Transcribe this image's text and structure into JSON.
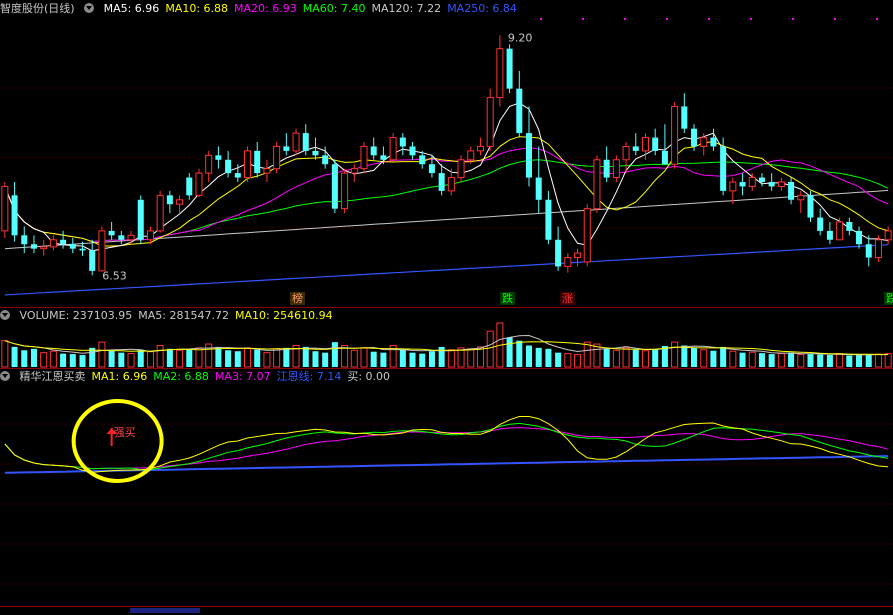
{
  "price_panel": {
    "name": "智度股份(日线)",
    "ma": [
      {
        "label": "MA5: 6.96",
        "color": "#ffffff"
      },
      {
        "label": "MA10: 6.88",
        "color": "#ffff00"
      },
      {
        "label": "MA20: 6.93",
        "color": "#ff00ff"
      },
      {
        "label": "MA60: 7.40",
        "color": "#00ff00"
      },
      {
        "label": "MA120: 7.22",
        "color": "#c8c8c8"
      },
      {
        "label": "MA250: 6.84",
        "color": "#3355ff"
      }
    ],
    "high_label": "9.20",
    "low_label": "6.53",
    "tags": [
      {
        "text": "榜",
        "color": "#ff9966"
      },
      {
        "text": "跌",
        "color": "#00ff00"
      },
      {
        "text": "涨",
        "color": "#ff3333"
      },
      {
        "text": "跌",
        "color": "#00ff00"
      }
    ]
  },
  "volume_panel": {
    "labels": [
      {
        "text": "VOLUME: 237103.95",
        "color": "#c8c8c8"
      },
      {
        "text": "MA5: 281547.72",
        "color": "#c8c8c8"
      },
      {
        "text": "MA10: 254610.94",
        "color": "#ffff00"
      }
    ]
  },
  "indicator_panel": {
    "labels": [
      {
        "text": "精华江恩买卖",
        "color": "#c8c8c8"
      },
      {
        "text": "MA1: 6.96",
        "color": "#ffff00"
      },
      {
        "text": "MA2: 6.88",
        "color": "#00ff00"
      },
      {
        "text": "MA3: 7.07",
        "color": "#ff00ff"
      },
      {
        "text": "江恩线: 7.14",
        "color": "#3355ff"
      },
      {
        "text": "买: 0.00",
        "color": "#c8c8c8"
      }
    ],
    "signal_label": "强买",
    "highlight_color": "#ffff00"
  },
  "candles": [
    [
      7.0,
      7.55,
      6.92,
      7.5
    ],
    [
      7.4,
      7.55,
      6.88,
      6.95
    ],
    [
      6.95,
      7.05,
      6.75,
      6.85
    ],
    [
      6.85,
      6.95,
      6.75,
      6.8
    ],
    [
      6.8,
      6.9,
      6.72,
      6.82
    ],
    [
      6.82,
      6.95,
      6.78,
      6.9
    ],
    [
      6.9,
      7.0,
      6.8,
      6.85
    ],
    [
      6.85,
      6.92,
      6.75,
      6.8
    ],
    [
      6.8,
      6.88,
      6.72,
      6.78
    ],
    [
      6.78,
      6.9,
      6.5,
      6.55
    ],
    [
      6.55,
      7.05,
      6.55,
      7.0
    ],
    [
      7.0,
      7.1,
      6.9,
      6.95
    ],
    [
      6.95,
      7.0,
      6.85,
      6.9
    ],
    [
      6.9,
      7.0,
      6.85,
      6.95
    ],
    [
      7.35,
      7.4,
      6.85,
      6.9
    ],
    [
      6.9,
      7.05,
      6.85,
      7.0
    ],
    [
      7.0,
      7.45,
      6.98,
      7.4
    ],
    [
      7.4,
      7.45,
      7.2,
      7.3
    ],
    [
      7.3,
      7.4,
      7.2,
      7.35
    ],
    [
      7.6,
      7.65,
      7.35,
      7.4
    ],
    [
      7.4,
      7.7,
      7.38,
      7.65
    ],
    [
      7.65,
      7.9,
      7.55,
      7.85
    ],
    [
      7.85,
      7.95,
      7.7,
      7.8
    ],
    [
      7.8,
      7.9,
      7.6,
      7.65
    ],
    [
      7.65,
      7.75,
      7.55,
      7.6
    ],
    [
      7.6,
      7.95,
      7.55,
      7.9
    ],
    [
      7.9,
      8.0,
      7.6,
      7.65
    ],
    [
      7.65,
      7.8,
      7.55,
      7.7
    ],
    [
      7.7,
      8.0,
      7.65,
      7.95
    ],
    [
      7.95,
      8.1,
      7.85,
      7.9
    ],
    [
      7.9,
      8.15,
      7.85,
      8.1
    ],
    [
      8.1,
      8.2,
      7.85,
      7.9
    ],
    [
      7.9,
      8.05,
      7.8,
      7.85
    ],
    [
      7.85,
      7.95,
      7.7,
      7.75
    ],
    [
      7.75,
      7.8,
      7.2,
      7.25
    ],
    [
      7.25,
      7.7,
      7.2,
      7.65
    ],
    [
      7.65,
      7.75,
      7.55,
      7.7
    ],
    [
      7.7,
      8.0,
      7.65,
      7.95
    ],
    [
      7.95,
      8.05,
      7.8,
      7.85
    ],
    [
      7.85,
      7.95,
      7.75,
      7.8
    ],
    [
      7.8,
      8.1,
      7.78,
      8.05
    ],
    [
      8.05,
      8.1,
      7.85,
      7.95
    ],
    [
      7.95,
      8.0,
      7.8,
      7.85
    ],
    [
      7.85,
      7.9,
      7.7,
      7.75
    ],
    [
      7.75,
      7.85,
      7.6,
      7.65
    ],
    [
      7.65,
      7.75,
      7.4,
      7.45
    ],
    [
      7.45,
      7.7,
      7.4,
      7.6
    ],
    [
      7.6,
      7.85,
      7.55,
      7.8
    ],
    [
      7.8,
      7.95,
      7.75,
      7.9
    ],
    [
      7.9,
      8.05,
      7.85,
      7.95
    ],
    [
      7.95,
      8.6,
      7.9,
      8.5
    ],
    [
      8.5,
      9.2,
      8.4,
      9.05
    ],
    [
      9.05,
      9.1,
      8.55,
      8.6
    ],
    [
      8.6,
      8.8,
      8.05,
      8.1
    ],
    [
      8.1,
      8.4,
      7.5,
      7.6
    ],
    [
      7.6,
      7.95,
      7.2,
      7.35
    ],
    [
      7.35,
      7.45,
      6.85,
      6.9
    ],
    [
      6.9,
      7.05,
      6.55,
      6.6
    ],
    [
      6.6,
      6.75,
      6.53,
      6.7
    ],
    [
      6.7,
      6.8,
      6.6,
      6.75
    ],
    [
      6.65,
      7.3,
      6.6,
      7.25
    ],
    [
      7.25,
      7.85,
      7.2,
      7.8
    ],
    [
      7.8,
      7.95,
      7.55,
      7.6
    ],
    [
      7.6,
      7.85,
      7.55,
      7.8
    ],
    [
      7.8,
      8.0,
      7.65,
      7.95
    ],
    [
      7.95,
      8.1,
      7.85,
      7.9
    ],
    [
      7.9,
      8.1,
      7.8,
      8.05
    ],
    [
      8.05,
      8.15,
      7.85,
      7.9
    ],
    [
      7.9,
      8.2,
      7.75,
      7.75
    ],
    [
      7.75,
      8.45,
      7.7,
      8.4
    ],
    [
      8.4,
      8.55,
      8.1,
      8.15
    ],
    [
      8.15,
      8.2,
      7.9,
      7.95
    ],
    [
      7.95,
      8.1,
      7.85,
      8.05
    ],
    [
      8.05,
      8.15,
      7.9,
      7.95
    ],
    [
      7.95,
      8.05,
      7.4,
      7.45
    ],
    [
      7.45,
      7.6,
      7.3,
      7.55
    ],
    [
      7.55,
      7.65,
      7.4,
      7.5
    ],
    [
      7.5,
      7.65,
      7.45,
      7.6
    ],
    [
      7.6,
      7.65,
      7.5,
      7.55
    ],
    [
      7.55,
      7.65,
      7.45,
      7.5
    ],
    [
      7.5,
      7.6,
      7.45,
      7.55
    ],
    [
      7.55,
      7.6,
      7.3,
      7.35
    ],
    [
      7.35,
      7.45,
      7.2,
      7.4
    ],
    [
      7.4,
      7.45,
      7.1,
      7.15
    ],
    [
      7.15,
      7.25,
      6.95,
      7.0
    ],
    [
      7.0,
      7.1,
      6.85,
      6.9
    ],
    [
      6.9,
      7.15,
      6.9,
      7.1
    ],
    [
      7.1,
      7.15,
      6.95,
      7.0
    ],
    [
      7.0,
      7.05,
      6.8,
      6.85
    ],
    [
      6.85,
      6.95,
      6.6,
      6.7
    ],
    [
      6.7,
      6.95,
      6.65,
      6.9
    ],
    [
      6.9,
      7.05,
      6.85,
      7.0
    ]
  ],
  "volumes": [
    55,
    42,
    35,
    38,
    30,
    33,
    28,
    27,
    25,
    40,
    52,
    35,
    30,
    28,
    36,
    32,
    45,
    38,
    35,
    38,
    40,
    48,
    42,
    35,
    33,
    40,
    36,
    30,
    38,
    40,
    45,
    42,
    33,
    30,
    52,
    45,
    35,
    40,
    32,
    30,
    45,
    36,
    30,
    28,
    33,
    42,
    36,
    40,
    38,
    42,
    75,
    92,
    62,
    55,
    45,
    40,
    38,
    30,
    28,
    26,
    52,
    48,
    38,
    35,
    40,
    36,
    34,
    38,
    44,
    52,
    45,
    40,
    36,
    34,
    42,
    33,
    30,
    31,
    29,
    27,
    28,
    30,
    26,
    27,
    26,
    25,
    28,
    24,
    25,
    26,
    27,
    28
  ]
}
